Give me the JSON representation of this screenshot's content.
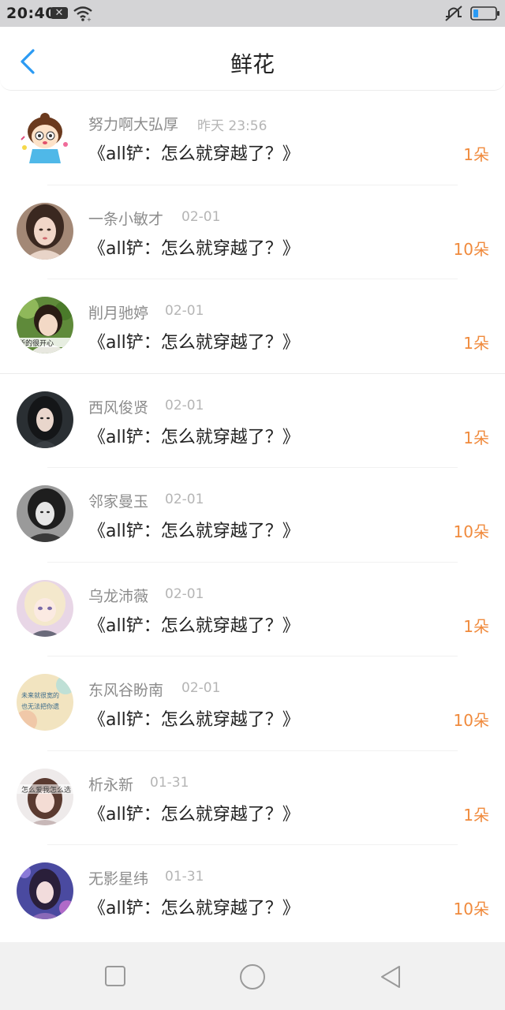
{
  "status_bar": {
    "time": "20:40"
  },
  "header": {
    "title": "鲜花"
  },
  "colors": {
    "accent": "#2b9af3",
    "count": "#f08a3c"
  },
  "items": [
    {
      "name": "努力啊大弘厚",
      "time": "昨天 23:56",
      "book": "《all铲：怎么就穿越了？》",
      "count": "1朵"
    },
    {
      "name": "一条小敏才",
      "time": "02-01",
      "book": "《all铲：怎么就穿越了？》",
      "count": "10朵"
    },
    {
      "name": "削月驰婷",
      "time": "02-01",
      "book": "《all铲：怎么就穿越了？》",
      "count": "1朵"
    },
    {
      "name": "西风俊贤",
      "time": "02-01",
      "book": "《all铲：怎么就穿越了？》",
      "count": "1朵"
    },
    {
      "name": "邻家曼玉",
      "time": "02-01",
      "book": "《all铲：怎么就穿越了？》",
      "count": "10朵"
    },
    {
      "name": "乌龙沛薇",
      "time": "02-01",
      "book": "《all铲：怎么就穿越了？》",
      "count": "1朵"
    },
    {
      "name": "东风谷盼南",
      "time": "02-01",
      "book": "《all铲：怎么就穿越了？》",
      "count": "10朵"
    },
    {
      "name": "析永新",
      "time": "01-31",
      "book": "《all铲：怎么就穿越了？》",
      "count": "1朵"
    },
    {
      "name": "无影星纬",
      "time": "01-31",
      "book": "《all铲：怎么就穿越了？》",
      "count": "10朵"
    }
  ],
  "avatar_texts": {
    "a3": "所的很开心",
    "a7_line1": "未来就很宽的",
    "a7_line2": "也无法把你遗",
    "a8": "怎么爱我怎么选"
  }
}
